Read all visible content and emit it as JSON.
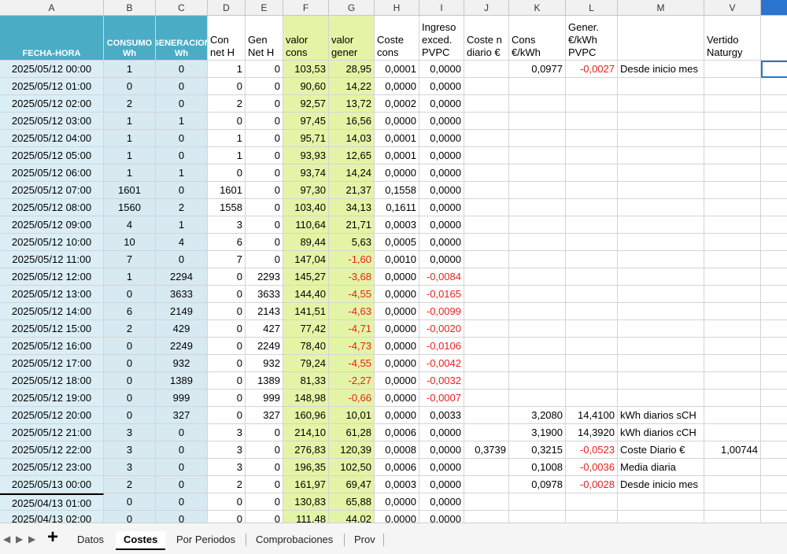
{
  "columns": [
    "A",
    "B",
    "C",
    "D",
    "E",
    "F",
    "G",
    "H",
    "I",
    "J",
    "K",
    "L",
    "M",
    "V",
    ""
  ],
  "headers": {
    "A": "FECHA-HORA",
    "B": "CONSUMO Wh",
    "C": "GENERACION Wh",
    "D": "Con net H",
    "E": "Gen Net H",
    "F": "valor cons",
    "G": "valor gener",
    "H": "Coste cons",
    "I": "Ingreso exced. PVPC",
    "J": "Coste n diario €",
    "K": "Cons €/kWh",
    "L": "Gener. €/kWh PVPC",
    "M": "",
    "V": "Vertido Naturgy"
  },
  "rows": [
    [
      "2025/05/12 00:00",
      "1",
      "0",
      "1",
      "0",
      "103,53",
      "28,95",
      "0,0001",
      "0,0000",
      "",
      "0,0977",
      "-0,0027",
      "Desde inicio mes",
      ""
    ],
    [
      "2025/05/12 01:00",
      "0",
      "0",
      "0",
      "0",
      "90,60",
      "14,22",
      "0,0000",
      "0,0000",
      "",
      "",
      "",
      "",
      ""
    ],
    [
      "2025/05/12 02:00",
      "2",
      "0",
      "2",
      "0",
      "92,57",
      "13,72",
      "0,0002",
      "0,0000",
      "",
      "",
      "",
      "",
      ""
    ],
    [
      "2025/05/12 03:00",
      "1",
      "1",
      "0",
      "0",
      "97,45",
      "16,56",
      "0,0000",
      "0,0000",
      "",
      "",
      "",
      "",
      ""
    ],
    [
      "2025/05/12 04:00",
      "1",
      "0",
      "1",
      "0",
      "95,71",
      "14,03",
      "0,0001",
      "0,0000",
      "",
      "",
      "",
      "",
      ""
    ],
    [
      "2025/05/12 05:00",
      "1",
      "0",
      "1",
      "0",
      "93,93",
      "12,65",
      "0,0001",
      "0,0000",
      "",
      "",
      "",
      "",
      ""
    ],
    [
      "2025/05/12 06:00",
      "1",
      "1",
      "0",
      "0",
      "93,74",
      "14,24",
      "0,0000",
      "0,0000",
      "",
      "",
      "",
      "",
      ""
    ],
    [
      "2025/05/12 07:00",
      "1601",
      "0",
      "1601",
      "0",
      "97,30",
      "21,37",
      "0,1558",
      "0,0000",
      "",
      "",
      "",
      "",
      ""
    ],
    [
      "2025/05/12 08:00",
      "1560",
      "2",
      "1558",
      "0",
      "103,40",
      "34,13",
      "0,1611",
      "0,0000",
      "",
      "",
      "",
      "",
      ""
    ],
    [
      "2025/05/12 09:00",
      "4",
      "1",
      "3",
      "0",
      "110,64",
      "21,71",
      "0,0003",
      "0,0000",
      "",
      "",
      "",
      "",
      ""
    ],
    [
      "2025/05/12 10:00",
      "10",
      "4",
      "6",
      "0",
      "89,44",
      "5,63",
      "0,0005",
      "0,0000",
      "",
      "",
      "",
      "",
      ""
    ],
    [
      "2025/05/12 11:00",
      "7",
      "0",
      "7",
      "0",
      "147,04",
      "-1,60",
      "0,0010",
      "0,0000",
      "",
      "",
      "",
      "",
      ""
    ],
    [
      "2025/05/12 12:00",
      "1",
      "2294",
      "0",
      "2293",
      "145,27",
      "-3,68",
      "0,0000",
      "-0,0084",
      "",
      "",
      "",
      "",
      ""
    ],
    [
      "2025/05/12 13:00",
      "0",
      "3633",
      "0",
      "3633",
      "144,40",
      "-4,55",
      "0,0000",
      "-0,0165",
      "",
      "",
      "",
      "",
      ""
    ],
    [
      "2025/05/12 14:00",
      "6",
      "2149",
      "0",
      "2143",
      "141,51",
      "-4,63",
      "0,0000",
      "-0,0099",
      "",
      "",
      "",
      "",
      ""
    ],
    [
      "2025/05/12 15:00",
      "2",
      "429",
      "0",
      "427",
      "77,42",
      "-4,71",
      "0,0000",
      "-0,0020",
      "",
      "",
      "",
      "",
      ""
    ],
    [
      "2025/05/12 16:00",
      "0",
      "2249",
      "0",
      "2249",
      "78,40",
      "-4,73",
      "0,0000",
      "-0,0106",
      "",
      "",
      "",
      "",
      ""
    ],
    [
      "2025/05/12 17:00",
      "0",
      "932",
      "0",
      "932",
      "79,24",
      "-4,55",
      "0,0000",
      "-0,0042",
      "",
      "",
      "",
      "",
      ""
    ],
    [
      "2025/05/12 18:00",
      "0",
      "1389",
      "0",
      "1389",
      "81,33",
      "-2,27",
      "0,0000",
      "-0,0032",
      "",
      "",
      "",
      "",
      ""
    ],
    [
      "2025/05/12 19:00",
      "0",
      "999",
      "0",
      "999",
      "148,98",
      "-0,66",
      "0,0000",
      "-0,0007",
      "",
      "",
      "",
      "",
      ""
    ],
    [
      "2025/05/12 20:00",
      "0",
      "327",
      "0",
      "327",
      "160,96",
      "10,01",
      "0,0000",
      "0,0033",
      "",
      "3,2080",
      "14,4100",
      "kWh diarios sCH",
      ""
    ],
    [
      "2025/05/12 21:00",
      "3",
      "0",
      "3",
      "0",
      "214,10",
      "61,28",
      "0,0006",
      "0,0000",
      "",
      "3,1900",
      "14,3920",
      "kWh diarios cCH",
      ""
    ],
    [
      "2025/05/12 22:00",
      "3",
      "0",
      "3",
      "0",
      "276,83",
      "120,39",
      "0,0008",
      "0,0000",
      "0,3739",
      "0,3215",
      "-0,0523",
      "Coste Diario €",
      "1,00744"
    ],
    [
      "2025/05/12 23:00",
      "3",
      "0",
      "3",
      "0",
      "196,35",
      "102,50",
      "0,0006",
      "0,0000",
      "",
      "0,1008",
      "-0,0036",
      "Media diaria",
      ""
    ],
    [
      "2025/05/13 00:00",
      "2",
      "0",
      "2",
      "0",
      "161,97",
      "69,47",
      "0,0003",
      "0,0000",
      "",
      "0,0978",
      "-0,0028",
      "Desde inicio mes",
      ""
    ],
    [
      "2025/04/13 01:00",
      "0",
      "0",
      "0",
      "0",
      "130,83",
      "65,88",
      "0,0000",
      "0,0000",
      "",
      "",
      "",
      "",
      ""
    ],
    [
      "2025/04/13 02:00",
      "0",
      "0",
      "0",
      "0",
      "111,48",
      "44,02",
      "0,0000",
      "0,0000",
      "",
      "",
      "",
      "",
      ""
    ]
  ],
  "tabs": [
    "Datos",
    "Costes",
    "Por Periodos",
    "Comprobaciones",
    "Prov"
  ],
  "active_tab": "Costes",
  "colors": {
    "header_blue": "#4bacc6",
    "date_fill": "#dbeef5",
    "value_fill": "#e4f4a6",
    "negative": "#e8201e",
    "selection": "#2a74d0"
  }
}
